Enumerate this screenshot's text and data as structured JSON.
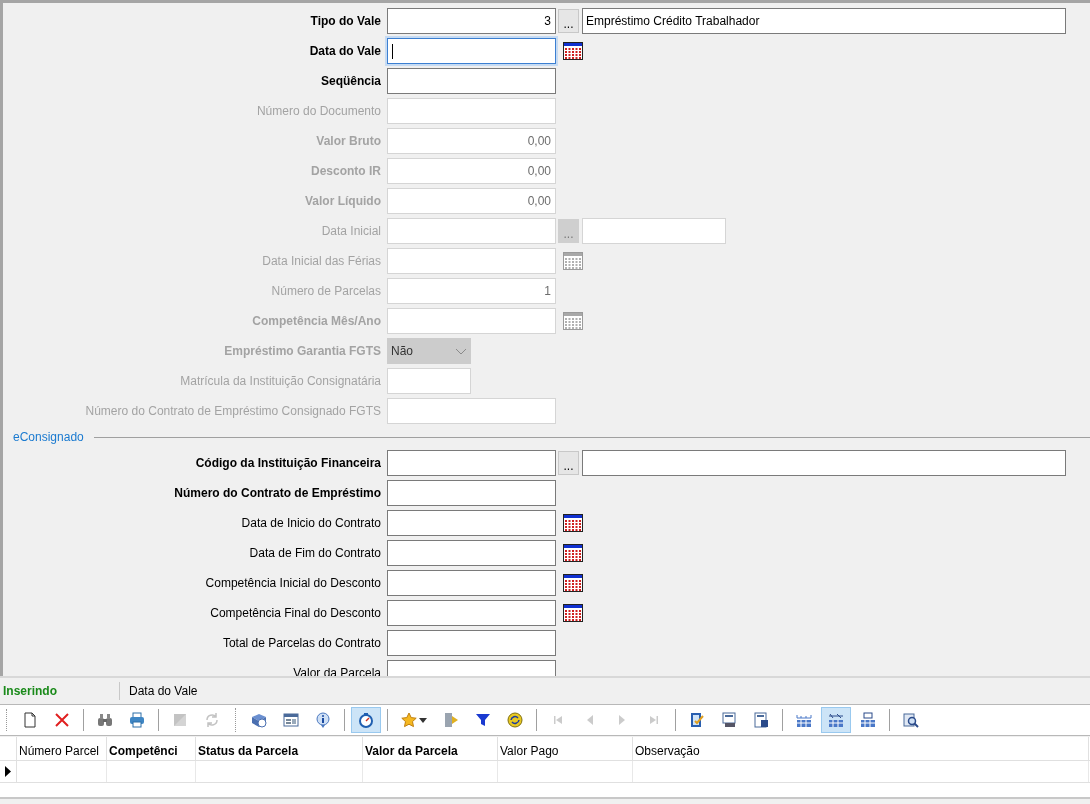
{
  "form": {
    "rows": [
      {
        "label": "Tipo do Vale",
        "bold": true,
        "disabled": false,
        "kind": "lookup",
        "value": "3",
        "right_aligned": true,
        "button_label": "...",
        "description": "Empréstimo Crédito Trabalhador",
        "wide": true
      },
      {
        "label": "Data do Vale",
        "bold": true,
        "disabled": false,
        "kind": "date",
        "focused": true
      },
      {
        "label": "Seqüência",
        "bold": true,
        "disabled": false,
        "kind": "text"
      },
      {
        "label": "Número do Documento",
        "bold": false,
        "disabled": true,
        "kind": "text"
      },
      {
        "label": "Valor Bruto",
        "bold": true,
        "disabled": true,
        "kind": "text",
        "value": "0,00",
        "right_aligned": true
      },
      {
        "label": "Desconto IR",
        "bold": true,
        "disabled": true,
        "kind": "text",
        "value": "0,00",
        "right_aligned": true
      },
      {
        "label": "Valor Líquido",
        "bold": true,
        "disabled": true,
        "kind": "text",
        "value": "0,00",
        "right_aligned": true
      },
      {
        "label": "Data Inicial",
        "bold": false,
        "disabled": true,
        "kind": "lookup",
        "button_label": "...",
        "wide": false
      },
      {
        "label": "Data Inicial das Férias",
        "bold": false,
        "disabled": true,
        "kind": "date"
      },
      {
        "label": "Número de Parcelas",
        "bold": false,
        "disabled": true,
        "kind": "text",
        "value": "1",
        "right_aligned": true
      },
      {
        "label": "Competência Mês/Ano",
        "bold": true,
        "disabled": true,
        "kind": "date"
      },
      {
        "label": "Empréstimo Garantia FGTS",
        "bold": true,
        "disabled": true,
        "kind": "select",
        "value": "Não"
      },
      {
        "label": "Matrícula da Instituição Consignatária",
        "bold": false,
        "disabled": true,
        "kind": "short"
      },
      {
        "label": "Número do Contrato de Empréstimo Consignado FGTS",
        "bold": false,
        "disabled": true,
        "kind": "text"
      }
    ],
    "section": {
      "title": "eConsignado",
      "rows": [
        {
          "label": "Código da Instituição Financeira",
          "bold": true,
          "disabled": false,
          "kind": "lookup",
          "button_label": "...",
          "wide": true
        },
        {
          "label": "Número do Contrato de Empréstimo",
          "bold": true,
          "disabled": false,
          "kind": "text"
        },
        {
          "label": "Data de Inicio do Contrato",
          "bold": false,
          "disabled": false,
          "kind": "date"
        },
        {
          "label": "Data de Fim do Contrato",
          "bold": false,
          "disabled": false,
          "kind": "date"
        },
        {
          "label": "Competência Inicial do Desconto",
          "bold": false,
          "disabled": false,
          "kind": "date"
        },
        {
          "label": "Competência Final do Desconto",
          "bold": false,
          "disabled": false,
          "kind": "date"
        },
        {
          "label": "Total de Parcelas do Contrato",
          "bold": false,
          "disabled": false,
          "kind": "text"
        },
        {
          "label": "Valor da Parcela",
          "bold": false,
          "disabled": false,
          "kind": "text"
        }
      ]
    }
  },
  "status_bar": {
    "mode": "Inserindo",
    "field": "Data do Vale"
  },
  "toolbar": [
    {
      "selected": false,
      "disabled": false
    },
    {
      "selected": false,
      "disabled": false
    },
    {
      "selected": false,
      "disabled": false
    },
    {
      "selected": false,
      "disabled": false
    },
    {
      "selected": false,
      "disabled": true
    },
    {
      "selected": false,
      "disabled": true
    },
    {
      "selected": false,
      "disabled": false
    },
    {
      "selected": false,
      "disabled": false
    },
    {
      "selected": false,
      "disabled": false
    },
    {
      "selected": true,
      "disabled": false
    },
    {
      "selected": false,
      "disabled": false
    },
    {
      "selected": false,
      "disabled": false
    },
    {
      "selected": false,
      "disabled": false
    },
    {
      "selected": false,
      "disabled": false
    },
    {
      "selected": false,
      "disabled": true
    },
    {
      "selected": false,
      "disabled": true
    },
    {
      "selected": false,
      "disabled": true
    },
    {
      "selected": false,
      "disabled": true
    },
    {
      "selected": false,
      "disabled": false
    },
    {
      "selected": false,
      "disabled": false
    },
    {
      "selected": false,
      "disabled": false
    },
    {
      "selected": false,
      "disabled": false
    },
    {
      "selected": true,
      "disabled": false
    },
    {
      "selected": false,
      "disabled": false
    },
    {
      "selected": false,
      "disabled": false
    }
  ],
  "table": {
    "columns": [
      {
        "label": "Número Parcel",
        "bold": false
      },
      {
        "label": "Competênci",
        "bold": true
      },
      {
        "label": "Status da Parcela",
        "bold": true
      },
      {
        "label": "Valor da Parcela",
        "bold": true
      },
      {
        "label": "Valor Pago",
        "bold": false
      },
      {
        "label": "Observação",
        "bold": false
      }
    ]
  }
}
